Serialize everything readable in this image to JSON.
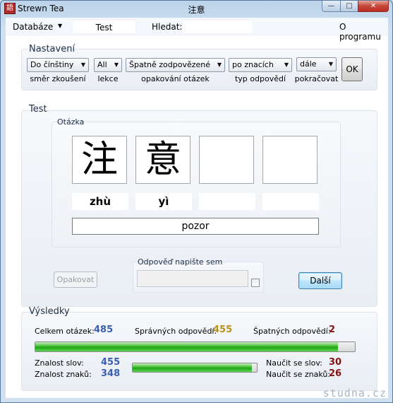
{
  "window": {
    "app_title": "Strewn Tea",
    "title": "注意",
    "minimize_glyph": "—",
    "maximize_glyph": "□",
    "close_glyph": "✕",
    "icon_glyph": "語"
  },
  "menu": {
    "database": "Databáze",
    "database_arrow": "▼",
    "test": "Test",
    "search_label": "Hledat:",
    "search_value": "",
    "about": "O programu"
  },
  "settings": {
    "group_label": "Nastavení",
    "direction": {
      "value": "Do čínštiny",
      "caption": "směr zkoušení"
    },
    "lesson": {
      "value": "All",
      "caption": "lekce"
    },
    "repeat": {
      "value": "Špatně zodpovězené",
      "caption": "opakování otázek"
    },
    "answer_type": {
      "value": "po znacích",
      "caption": "typ odpovědí"
    },
    "continue": {
      "value": "dále",
      "caption": "pokračovat"
    },
    "ok_label": "OK"
  },
  "test": {
    "group_label": "Test",
    "question_label": "Otázka",
    "characters": [
      "注",
      "意",
      "",
      ""
    ],
    "pinyin": [
      "zhù",
      "yì",
      "",
      ""
    ],
    "meaning": "pozor",
    "answer_label": "Odpověď napište sem",
    "answer_value": "",
    "repeat_button": "Opakovat",
    "next_button": "Další"
  },
  "results": {
    "group_label": "Výsledky",
    "total_label": "Celkem otázek:",
    "total_value": "485",
    "correct_label": "Správných odpovědí:",
    "correct_value": "455",
    "wrong_label": "Špatných odpovědí:",
    "wrong_value": "2",
    "overall_progress": 0.948,
    "words_label": "Znalost slov:",
    "words_value": "455",
    "chars_label": "Znalost znaků:",
    "chars_value": "348",
    "knowledge_progress": 0.96,
    "learn_words_label": "Naučit se slov:",
    "learn_words_value": "30",
    "learn_chars_label": "Naučit se znaků:",
    "learn_chars_value": "26"
  },
  "colors": {
    "blue_value": "#3a5fb0",
    "gold_value": "#b8901a",
    "red_value": "#8a1010"
  },
  "watermark": "studna.cz"
}
